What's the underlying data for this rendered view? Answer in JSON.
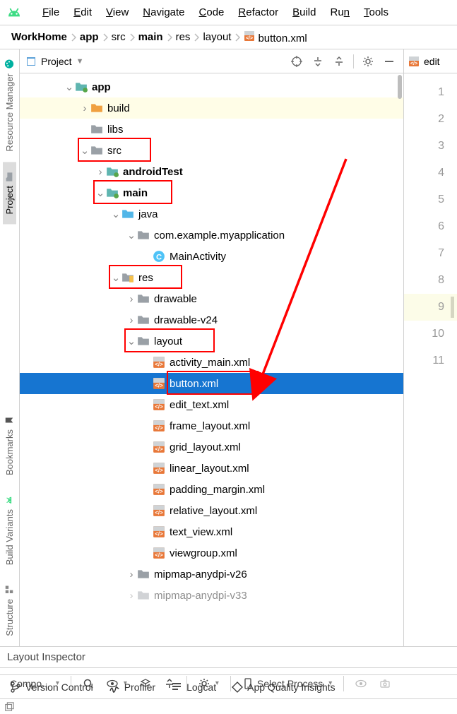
{
  "menu": {
    "items": [
      {
        "u": "F",
        "rest": "ile"
      },
      {
        "u": "E",
        "rest": "dit"
      },
      {
        "u": "V",
        "rest": "iew"
      },
      {
        "u": "N",
        "rest": "avigate"
      },
      {
        "u": "C",
        "rest": "ode"
      },
      {
        "u": "R",
        "rest": "efactor"
      },
      {
        "u": "B",
        "rest": "uild"
      },
      {
        "u": "R",
        "rest": "u",
        "u2": "n"
      },
      {
        "u": "T",
        "rest": "ools"
      }
    ]
  },
  "breadcrumb": {
    "items": [
      "WorkHome",
      "app",
      "src",
      "main",
      "res",
      "layout",
      "button.xml"
    ],
    "bold_indices": [
      0,
      1,
      3
    ]
  },
  "left_tabs": {
    "resource_manager": "Resource Manager",
    "project": "Project",
    "bookmarks": "Bookmarks",
    "build_variants": "Build Variants",
    "structure": "Structure"
  },
  "panel": {
    "title": "Project"
  },
  "editor": {
    "tab_label": "edit",
    "line_numbers": [
      1,
      2,
      3,
      4,
      5,
      6,
      7,
      8,
      9,
      10,
      11
    ],
    "highlighted_line": 9
  },
  "tree": {
    "rows": [
      {
        "indent": 1,
        "arrow": "down",
        "icon": "module",
        "label": "app",
        "bold": true
      },
      {
        "indent": 2,
        "arrow": "right",
        "icon": "folder-build",
        "label": "build",
        "build": true
      },
      {
        "indent": 2,
        "arrow": "",
        "icon": "folder-gray",
        "label": "libs"
      },
      {
        "indent": 2,
        "arrow": "down",
        "icon": "folder-gray",
        "label": "src",
        "redbox": true
      },
      {
        "indent": 3,
        "arrow": "right",
        "icon": "module",
        "label": "androidTest",
        "bold": true
      },
      {
        "indent": 3,
        "arrow": "down",
        "icon": "module",
        "label": "main",
        "bold": true,
        "redbox": true
      },
      {
        "indent": 4,
        "arrow": "down",
        "icon": "folder-blue",
        "label": "java"
      },
      {
        "indent": 5,
        "arrow": "down",
        "icon": "folder-gray",
        "label": "com.example.myapplication"
      },
      {
        "indent": 6,
        "arrow": "",
        "icon": "class",
        "label": "MainActivity"
      },
      {
        "indent": 4,
        "arrow": "down",
        "icon": "folder-res",
        "label": "res",
        "redbox": true
      },
      {
        "indent": 5,
        "arrow": "right",
        "icon": "folder-gray",
        "label": "drawable"
      },
      {
        "indent": 5,
        "arrow": "right",
        "icon": "folder-gray",
        "label": "drawable-v24"
      },
      {
        "indent": 5,
        "arrow": "down",
        "icon": "folder-gray",
        "label": "layout",
        "redbox": true
      },
      {
        "indent": 6,
        "arrow": "",
        "icon": "xml",
        "label": "activity_main.xml"
      },
      {
        "indent": 6,
        "arrow": "",
        "icon": "xml",
        "label": "button.xml",
        "selected": true,
        "redbox": true
      },
      {
        "indent": 6,
        "arrow": "",
        "icon": "xml",
        "label": "edit_text.xml"
      },
      {
        "indent": 6,
        "arrow": "",
        "icon": "xml",
        "label": "frame_layout.xml"
      },
      {
        "indent": 6,
        "arrow": "",
        "icon": "xml",
        "label": "grid_layout.xml"
      },
      {
        "indent": 6,
        "arrow": "",
        "icon": "xml",
        "label": "linear_layout.xml"
      },
      {
        "indent": 6,
        "arrow": "",
        "icon": "xml",
        "label": "padding_margin.xml"
      },
      {
        "indent": 6,
        "arrow": "",
        "icon": "xml",
        "label": "relative_layout.xml"
      },
      {
        "indent": 6,
        "arrow": "",
        "icon": "xml",
        "label": "text_view.xml"
      },
      {
        "indent": 6,
        "arrow": "",
        "icon": "xml",
        "label": "viewgroup.xml"
      },
      {
        "indent": 5,
        "arrow": "right",
        "icon": "folder-gray",
        "label": "mipmap-anydpi-v26"
      },
      {
        "indent": 5,
        "arrow": "right",
        "icon": "folder-gray",
        "label": "mipmap-anydpi-v33",
        "faded": true
      }
    ]
  },
  "layout_inspector": {
    "label": "Layout Inspector"
  },
  "tool_row": {
    "compo": "Compo...",
    "select_process": "Select Process"
  },
  "bottom_bar": {
    "version_control": "Version Control",
    "profiler": "Profiler",
    "logcat": "Logcat",
    "app_quality": "App Quality Insights"
  }
}
